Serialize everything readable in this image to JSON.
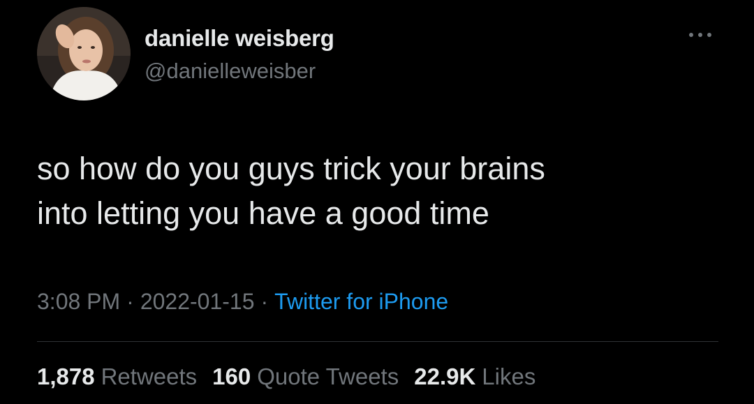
{
  "author": {
    "display_name": "danielle weisberg",
    "handle": "@danielleweisber",
    "avatar_icon": "profile-photo"
  },
  "tweet": {
    "text_lines": [
      "so how do you guys trick your brains",
      "into letting you have a good time"
    ],
    "time": "3:08 PM",
    "separator": "·",
    "date": "2022-01-15",
    "source": "Twitter for iPhone"
  },
  "stats": {
    "retweets_count": "1,878",
    "retweets_label": "Retweets",
    "quotes_count": "160",
    "quotes_label": "Quote Tweets",
    "likes_count": "22.9K",
    "likes_label": "Likes"
  },
  "menu": {
    "icon": "more-horizontal-icon"
  },
  "colors": {
    "background": "#000000",
    "primary_text": "#e7e9ea",
    "secondary_text": "#71767b",
    "link": "#1d9bf0",
    "divider": "#2f3336"
  }
}
